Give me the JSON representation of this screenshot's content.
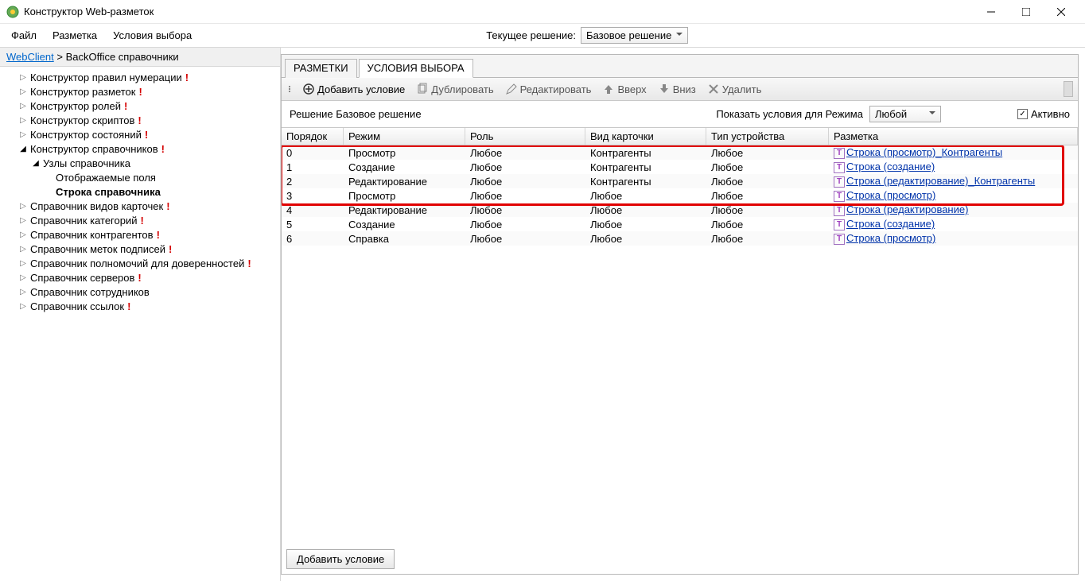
{
  "window": {
    "title": "Конструктор Web-разметок"
  },
  "menu": {
    "items": [
      "Файл",
      "Разметка",
      "Условия выбора"
    ],
    "current_label": "Текущее решение:",
    "current_value": "Базовое решение"
  },
  "breadcrumb": {
    "root": "WebClient",
    "sep": " > ",
    "rest": "BackOffice справочники"
  },
  "tree": [
    {
      "label": "Конструктор правил нумерации",
      "excl": true,
      "indent": 1,
      "tri": "▷"
    },
    {
      "label": "Конструктор разметок",
      "excl": true,
      "indent": 1,
      "tri": "▷"
    },
    {
      "label": "Конструктор ролей",
      "excl": true,
      "indent": 1,
      "tri": "▷"
    },
    {
      "label": "Конструктор скриптов",
      "excl": true,
      "indent": 1,
      "tri": "▷"
    },
    {
      "label": "Конструктор состояний",
      "excl": true,
      "indent": 1,
      "tri": "▷"
    },
    {
      "label": "Конструктор справочников",
      "excl": true,
      "indent": 1,
      "tri": "◢",
      "open": true
    },
    {
      "label": "Узлы справочника",
      "indent": 2,
      "tri": "◢",
      "open": true
    },
    {
      "label": "Отображаемые поля",
      "indent": 3,
      "tri": ""
    },
    {
      "label": "Строка справочника",
      "indent": 3,
      "tri": "",
      "bold": true
    },
    {
      "label": "Справочник видов карточек",
      "excl": true,
      "indent": 1,
      "tri": "▷"
    },
    {
      "label": "Справочник категорий",
      "excl": true,
      "indent": 1,
      "tri": "▷"
    },
    {
      "label": "Справочник контрагентов",
      "excl": true,
      "indent": 1,
      "tri": "▷"
    },
    {
      "label": "Справочник меток подписей",
      "excl": true,
      "indent": 1,
      "tri": "▷"
    },
    {
      "label": "Справочник полномочий для доверенностей",
      "excl": true,
      "indent": 1,
      "tri": "▷"
    },
    {
      "label": "Справочник серверов",
      "excl": true,
      "indent": 1,
      "tri": "▷"
    },
    {
      "label": "Справочник сотрудников",
      "indent": 1,
      "tri": "▷"
    },
    {
      "label": "Справочник ссылок",
      "excl": true,
      "indent": 1,
      "tri": "▷"
    }
  ],
  "tabs": [
    "РАЗМЕТКИ",
    "УСЛОВИЯ ВЫБОРА"
  ],
  "active_tab": 1,
  "toolbar": {
    "add": "Добавить условие",
    "dup": "Дублировать",
    "edit": "Редактировать",
    "up": "Вверх",
    "down": "Вниз",
    "del": "Удалить"
  },
  "filter": {
    "solution_label": "Решение Базовое решение",
    "show_label": "Показать условия для Режима",
    "mode_value": "Любой",
    "active_label": "Активно"
  },
  "grid": {
    "headers": [
      "Порядок",
      "Режим",
      "Роль",
      "Вид карточки",
      "Тип устройства",
      "Разметка"
    ],
    "rows": [
      {
        "order": "0",
        "mode": "Просмотр",
        "role": "Любое",
        "card": "Контрагенты",
        "dev": "Любое",
        "layout": "Строка (просмотр)_Контрагенты"
      },
      {
        "order": "1",
        "mode": "Создание",
        "role": "Любое",
        "card": "Контрагенты",
        "dev": "Любое",
        "layout": "Строка (создание)"
      },
      {
        "order": "2",
        "mode": "Редактирование",
        "role": "Любое",
        "card": "Контрагенты",
        "dev": "Любое",
        "layout": "Строка (редактирование)_Контрагенты"
      },
      {
        "order": "3",
        "mode": "Просмотр",
        "role": "Любое",
        "card": "Любое",
        "dev": "Любое",
        "layout": "Строка (просмотр)"
      },
      {
        "order": "4",
        "mode": "Редактирование",
        "role": "Любое",
        "card": "Любое",
        "dev": "Любое",
        "layout": "Строка (редактирование)"
      },
      {
        "order": "5",
        "mode": "Создание",
        "role": "Любое",
        "card": "Любое",
        "dev": "Любое",
        "layout": "Строка (создание)"
      },
      {
        "order": "6",
        "mode": "Справка",
        "role": "Любое",
        "card": "Любое",
        "dev": "Любое",
        "layout": "Строка (просмотр)"
      }
    ]
  },
  "footer": {
    "add": "Добавить условие"
  }
}
